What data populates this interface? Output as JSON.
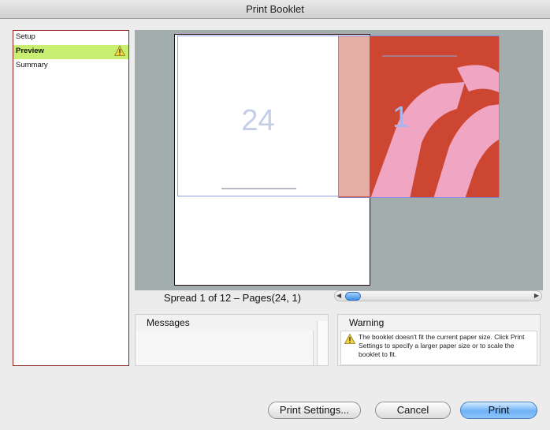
{
  "window": {
    "title": "Print Booklet"
  },
  "nav": {
    "items": [
      {
        "label": "Setup",
        "selected": false,
        "warning": false
      },
      {
        "label": "Preview",
        "selected": true,
        "warning": true
      },
      {
        "label": "Summary",
        "selected": false,
        "warning": false
      }
    ]
  },
  "preview": {
    "left_page_number": "24",
    "right_page_number": "1",
    "spread_label": "Spread 1 of 12 – Pages(24, 1)"
  },
  "messages": {
    "title": "Messages"
  },
  "warning": {
    "title": "Warning",
    "text": "The booklet doesn't fit the current paper size. Click Print Settings to specify a larger paper size or to scale the booklet to fit."
  },
  "buttons": {
    "print_settings": "Print Settings...",
    "cancel": "Cancel",
    "print": "Print"
  },
  "colors": {
    "selected_nav": "#c8ee72",
    "right_page_red": "#cc4632",
    "default_button": "#6fb2f6"
  }
}
